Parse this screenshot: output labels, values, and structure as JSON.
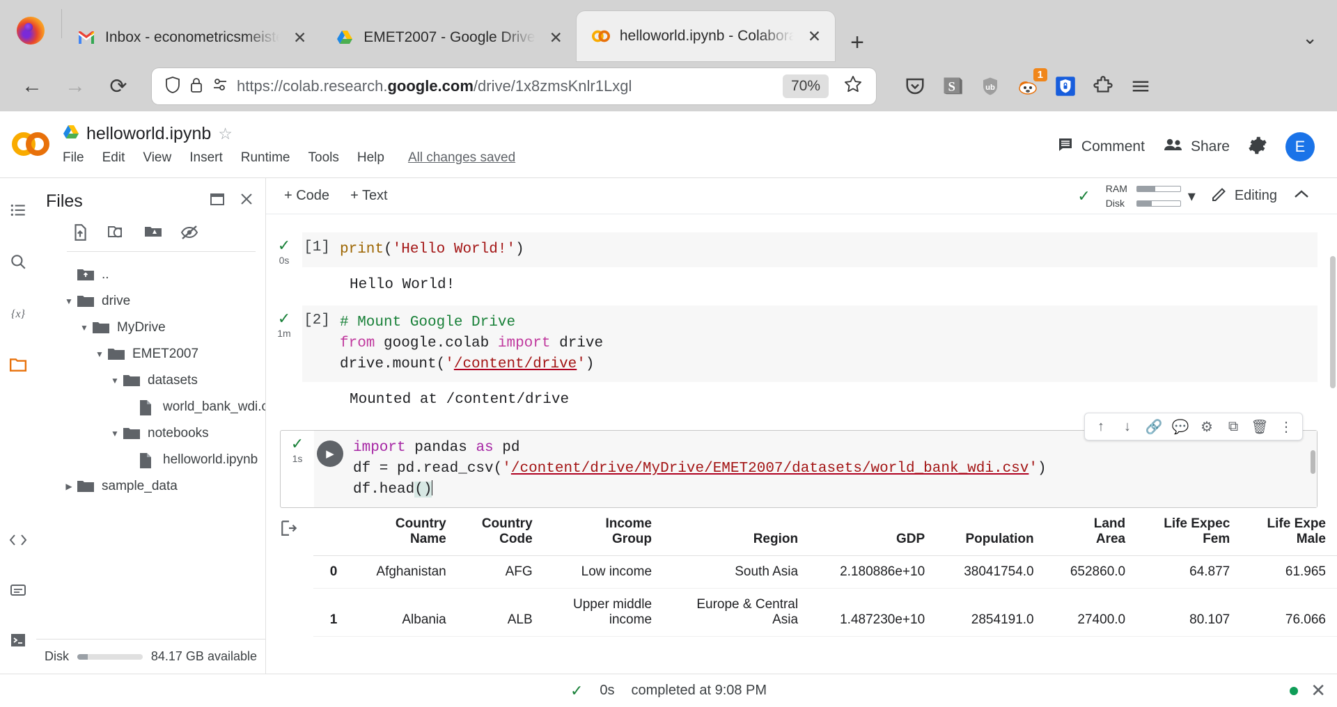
{
  "browser": {
    "tabs": [
      {
        "title": "Inbox - econometricsmeister@",
        "icon": "gmail-icon",
        "active": false
      },
      {
        "title": "EMET2007 - Google Drive",
        "icon": "google-drive-icon",
        "active": false
      },
      {
        "title": "helloworld.ipynb - Colaborato",
        "icon": "colab-icon",
        "active": true
      }
    ],
    "new_tab_label": "+",
    "tab_list_chevron": "⌄",
    "nav": {
      "back": "←",
      "forward": "→",
      "reload": "⟳"
    },
    "url": {
      "prefix": "https://colab.research.",
      "domain": "google.com",
      "path": "/drive/1x8zmsKnlr1Lxgl",
      "zoom": "70%"
    },
    "extensions": [
      {
        "name": "pocket-icon"
      },
      {
        "name": "stylus-icon",
        "label": "S"
      },
      {
        "name": "ublock-origin-icon"
      },
      {
        "name": "privacy-badger-icon",
        "badge": "1"
      },
      {
        "name": "bitwarden-icon"
      },
      {
        "name": "extensions-puzzle-icon"
      },
      {
        "name": "app-menu-icon"
      }
    ]
  },
  "colab": {
    "logo": "colab-logo",
    "notebook_name": "helloworld.ipynb",
    "star_label": "☆",
    "menus": [
      "File",
      "Edit",
      "View",
      "Insert",
      "Runtime",
      "Tools",
      "Help"
    ],
    "save_status": "All changes saved",
    "comment_label": "Comment",
    "share_label": "Share",
    "settings_icon": "gear-icon",
    "avatar_initial": "E"
  },
  "files_panel": {
    "title": "Files",
    "header_buttons": [
      "new-window-icon",
      "close-icon"
    ],
    "toolbar_icons": [
      "upload-file-icon",
      "refresh-folder-icon",
      "mount-drive-icon",
      "hide-hidden-icon"
    ],
    "tree": [
      {
        "label": "..",
        "icon": "parent-folder-icon",
        "depth": 1,
        "caret": ""
      },
      {
        "label": "drive",
        "icon": "folder-icon",
        "depth": 1,
        "caret": "expanded"
      },
      {
        "label": "MyDrive",
        "icon": "folder-icon",
        "depth": 2,
        "caret": "expanded"
      },
      {
        "label": "EMET2007",
        "icon": "folder-icon",
        "depth": 3,
        "caret": "expanded"
      },
      {
        "label": "datasets",
        "icon": "folder-icon",
        "depth": 4,
        "caret": "expanded"
      },
      {
        "label": "world_bank_wdi.csv",
        "icon": "file-icon",
        "depth": 5,
        "caret": ""
      },
      {
        "label": "notebooks",
        "icon": "folder-icon",
        "depth": 4,
        "caret": "expanded"
      },
      {
        "label": "helloworld.ipynb",
        "icon": "file-icon",
        "depth": 5,
        "caret": ""
      },
      {
        "label": "sample_data",
        "icon": "folder-icon",
        "depth": 1,
        "caret": "collapsed"
      }
    ],
    "disk_label": "Disk",
    "disk_available": "84.17 GB available"
  },
  "rail_icons": [
    {
      "name": "table-of-contents-icon",
      "glyph": "☰"
    },
    {
      "name": "search-icon",
      "glyph": "⚲"
    },
    {
      "name": "variables-icon",
      "glyph": "{x}"
    },
    {
      "name": "files-icon",
      "glyph": "folder",
      "selected": true
    }
  ],
  "rail_bottom_icons": [
    {
      "name": "code-snippets-icon",
      "glyph": "<>"
    },
    {
      "name": "commands-icon",
      "glyph": "⌸"
    },
    {
      "name": "terminal-icon",
      "glyph": ">_"
    }
  ],
  "notebook_toolbar": {
    "add_code": "+ Code",
    "add_text": "+ Text",
    "ram_label": "RAM",
    "disk_label": "Disk",
    "connect_chevron": "▾",
    "editing_label": "Editing",
    "collapse_chevron": "⌃"
  },
  "cells": [
    {
      "exec_count": "[1]",
      "status_icon": "check-icon",
      "run_time": "0s",
      "code_lines": [
        [
          {
            "t": "print",
            "c": "fn"
          },
          {
            "t": "(",
            "c": ""
          },
          {
            "t": "'Hello World!'",
            "c": "str"
          },
          {
            "t": ")",
            "c": ""
          }
        ]
      ],
      "output": "Hello World!"
    },
    {
      "exec_count": "[2]",
      "status_icon": "check-icon",
      "run_time": "1m",
      "code_lines": [
        [
          {
            "t": "# Mount Google Drive",
            "c": "com"
          }
        ],
        [
          {
            "t": "from",
            "c": "kw"
          },
          {
            "t": " google.colab ",
            "c": ""
          },
          {
            "t": "import",
            "c": "kw"
          },
          {
            "t": " drive",
            "c": ""
          }
        ],
        [
          {
            "t": "drive.mount(",
            "c": ""
          },
          {
            "t": "'",
            "c": "str"
          },
          {
            "t": "/content/drive",
            "c": "str-squig"
          },
          {
            "t": "'",
            "c": "str"
          },
          {
            "t": ")",
            "c": ""
          }
        ]
      ],
      "output": "Mounted at /content/drive"
    },
    {
      "exec_count": "",
      "status_icon": "check-icon",
      "run_time": "1s",
      "active": true,
      "run_button": "run-cell-button",
      "code_lines": [
        [
          {
            "t": "import",
            "c": "kw"
          },
          {
            "t": " pandas ",
            "c": ""
          },
          {
            "t": "as",
            "c": "kw"
          },
          {
            "t": " pd",
            "c": ""
          }
        ],
        [
          {
            "t": "df = pd.read_csv(",
            "c": ""
          },
          {
            "t": "'",
            "c": "str"
          },
          {
            "t": "/content/drive/MyDrive/EMET2007/datasets/world_bank_wdi.csv",
            "c": "str-squig"
          },
          {
            "t": "'",
            "c": "str"
          },
          {
            "t": ")",
            "c": ""
          }
        ],
        [
          {
            "t": "df.head()",
            "c": "cursor"
          }
        ]
      ],
      "toolbar_icons": [
        "move-cell-up-icon",
        "move-cell-down-icon",
        "link-to-cell-icon",
        "add-comment-icon",
        "cell-settings-icon",
        "mirror-cell-icon",
        "delete-cell-icon",
        "more-options-icon"
      ]
    }
  ],
  "dataframe": {
    "output_icon": "output-arrow-icon",
    "columns": [
      "",
      "Country\nName",
      "Country\nCode",
      "Income\nGroup",
      "Region",
      "GDP",
      "Population",
      "Land\nArea",
      "Life Expec\nFem",
      "Life Expe\nMale"
    ],
    "rows": [
      [
        "0",
        "Afghanistan",
        "AFG",
        "Low income",
        "South Asia",
        "2.180886e+10",
        "38041754.0",
        "652860.0",
        "64.877",
        "61.965"
      ],
      [
        "1",
        "Albania",
        "ALB",
        "Upper middle\nincome",
        "Europe & Central\nAsia",
        "1.487230e+10",
        "2854191.0",
        "27400.0",
        "80.107",
        "76.066"
      ]
    ]
  },
  "statusbar": {
    "check_icon": "check-icon",
    "elapsed": "0s",
    "completed": "completed at 9:08 PM",
    "indicator": "connected-dot",
    "close_label": "✕"
  },
  "colors": {
    "accent_orange": "#e8710a",
    "blue": "#1a73e8",
    "green": "#188038",
    "string_red": "#a31515",
    "keyword_purple": "#a626a4"
  }
}
